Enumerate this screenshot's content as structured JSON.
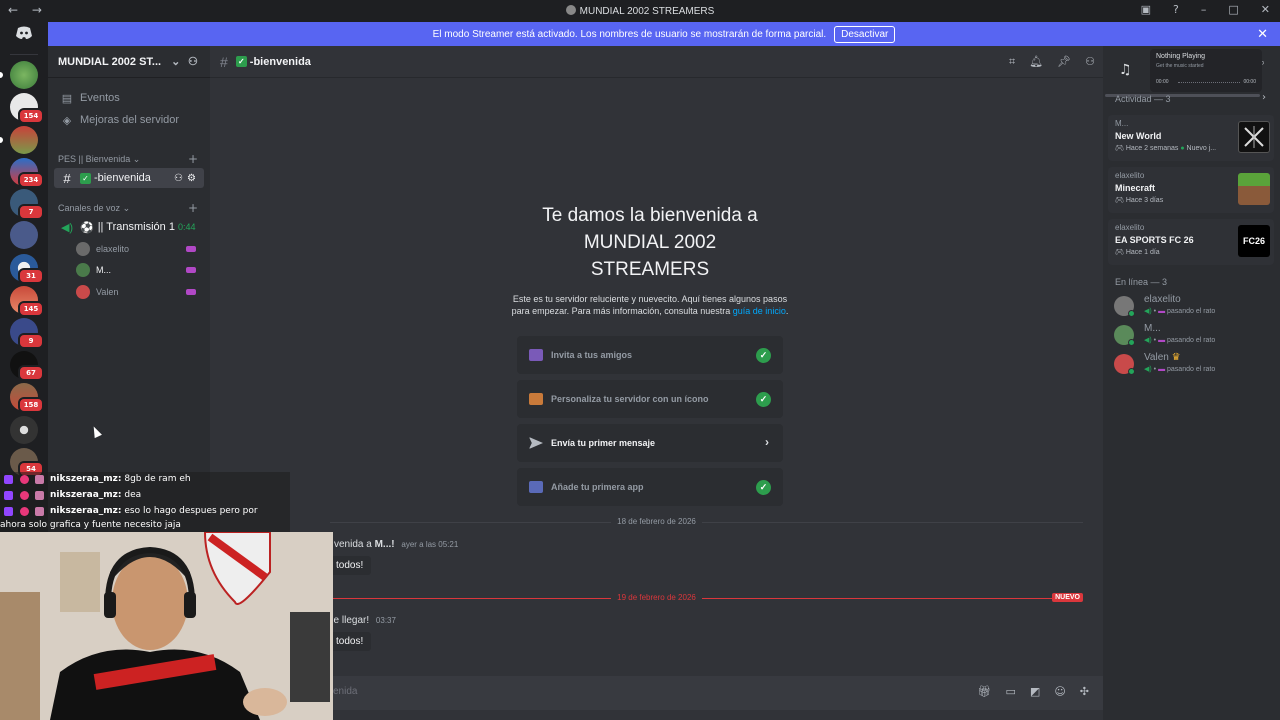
{
  "titlebar": {
    "title": "MUNDIAL 2002 STREAMERS",
    "back": "←",
    "forward": "→"
  },
  "banner": {
    "text": "El modo Streamer está activado. Los nombres de usuario se mostrarán de forma parcial.",
    "button": "Desactivar",
    "close": "✕"
  },
  "servers": [
    {
      "badge": ""
    },
    {
      "badge": "154"
    },
    {
      "badge": ""
    },
    {
      "badge": "234"
    },
    {
      "badge": "7"
    },
    {
      "badge": ""
    },
    {
      "badge": "31"
    },
    {
      "badge": "145"
    },
    {
      "badge": "9"
    },
    {
      "badge": "67"
    },
    {
      "badge": "158"
    },
    {
      "badge": ""
    },
    {
      "badge": "54"
    }
  ],
  "sidebar": {
    "server_name": "MUNDIAL 2002 ST...",
    "events": "Eventos",
    "boosts": "Mejoras del servidor",
    "category1": "PES || Bienvenida",
    "channel_welcome": "-bienvenida",
    "category2": "Canales de voz",
    "voice_channel": "|| Transmisión 1",
    "voice_time": "0:44",
    "voice_users": [
      "elaxelito",
      "M...",
      "Valen"
    ]
  },
  "chat": {
    "channel": "-bienvenida",
    "welcome_title_1": "Te damos la bienvenida a",
    "welcome_title_2": "MUNDIAL 2002",
    "welcome_title_3": "STREAMERS",
    "welcome_text": "Este es tu servidor reluciente y nuevecito. Aquí tienes algunos pasos para empezar. Para más información, consulta nuestra",
    "welcome_link": "guía de inicio",
    "welcome_end": ".",
    "tasks": [
      {
        "label": "Invita a tus amigos",
        "done": true
      },
      {
        "label": "Personaliza tu servidor con un ícono",
        "done": true
      },
      {
        "label": "Envía tu primer mensaje",
        "done": false
      },
      {
        "label": "Añade tu primera app",
        "done": true
      }
    ],
    "date1": "18 de febrero de 2026",
    "msg1_text": "venida a",
    "msg1_user": "M...!",
    "msg1_time": "ayer a las 05:21",
    "msg1_button": "todos!",
    "date2": "19 de febrero de 2026",
    "new_label": "NUEVO",
    "msg2_text": "de llegar!",
    "msg2_time": "03:37",
    "msg2_button": "todos!",
    "composer_placeholder": "venida"
  },
  "music": {
    "title": "Nothing Playing",
    "subtitle": "Get the music started",
    "start": "00:00",
    "end": "00:00"
  },
  "activity": {
    "title": "Actividad — 3",
    "items": [
      {
        "user": "M...",
        "game": "New World",
        "when": "Hace 2 semanas",
        "extra": "Nuevo j..."
      },
      {
        "user": "elaxelito",
        "game": "Minecraft",
        "when": "Hace 3 días",
        "extra": ""
      },
      {
        "user": "elaxelito",
        "game": "EA SPORTS FC 26",
        "when": "Hace 1 día",
        "extra": ""
      }
    ],
    "ea_logo": "FC26"
  },
  "members": {
    "title": "En línea — 3",
    "list": [
      {
        "name": "elaxelito",
        "status": "pasando el rato"
      },
      {
        "name": "M...",
        "status": "pasando el rato"
      },
      {
        "name": "Valen",
        "status": "pasando el rato"
      }
    ]
  },
  "overlay_chat": [
    {
      "user": "nikszeraa_mz:",
      "text": "8gb de ram eh"
    },
    {
      "user": "nikszeraa_mz:",
      "text": "dea"
    },
    {
      "user": "nikszeraa_mz:",
      "text": "eso lo hago despues pero por"
    }
  ],
  "overlay_chat_cont": "ahora solo grafica y fuente necesito jaja",
  "colors": {
    "accent": "#5865f2",
    "online": "#23a55a",
    "danger": "#da373c",
    "stream": "#b148c6"
  }
}
